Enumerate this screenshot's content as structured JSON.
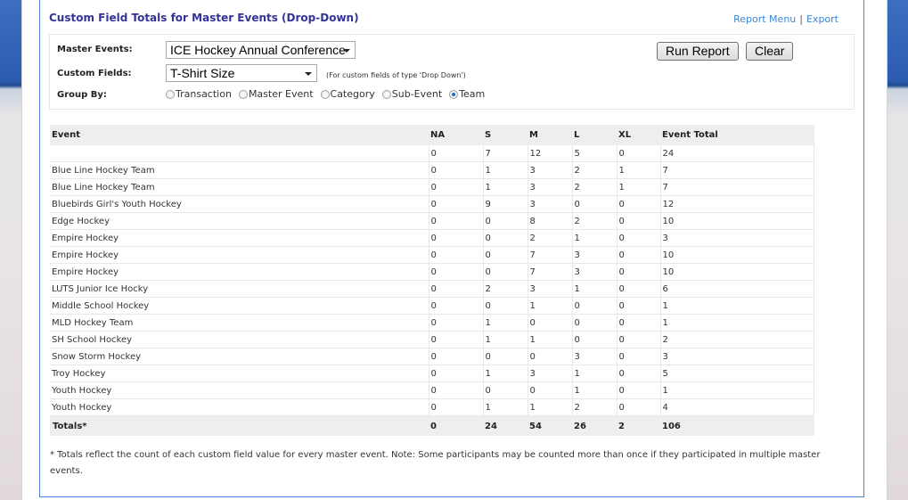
{
  "header": {
    "title": "Custom Field Totals for Master Events (Drop-Down)",
    "report_menu_link": "Report Menu",
    "separator": "|",
    "export_link": "Export"
  },
  "filters": {
    "master_events_label": "Master Events:",
    "master_events_value": "ICE Hockey Annual Conference",
    "custom_fields_label": "Custom Fields:",
    "custom_fields_value": "T-Shirt Size",
    "custom_fields_hint": "(For custom fields of type 'Drop Down')",
    "group_by_label": "Group By:",
    "group_by_options": [
      {
        "label": "Transaction",
        "selected": false
      },
      {
        "label": "Master Event",
        "selected": false
      },
      {
        "label": "Category",
        "selected": false
      },
      {
        "label": "Sub-Event",
        "selected": false
      },
      {
        "label": "Team",
        "selected": true
      }
    ],
    "run_report_button": "Run Report",
    "clear_button": "Clear"
  },
  "table": {
    "columns": [
      "Event",
      "NA",
      "S",
      "M",
      "L",
      "XL",
      "Event Total"
    ],
    "rows": [
      [
        "",
        "0",
        "7",
        "12",
        "5",
        "0",
        "24"
      ],
      [
        "Blue Line Hockey Team",
        "0",
        "1",
        "3",
        "2",
        "1",
        "7"
      ],
      [
        "Blue Line Hockey Team",
        "0",
        "1",
        "3",
        "2",
        "1",
        "7"
      ],
      [
        "Bluebirds Girl's Youth Hockey",
        "0",
        "9",
        "3",
        "0",
        "0",
        "12"
      ],
      [
        "Edge Hockey",
        "0",
        "0",
        "8",
        "2",
        "0",
        "10"
      ],
      [
        "Empire Hockey",
        "0",
        "0",
        "2",
        "1",
        "0",
        "3"
      ],
      [
        "Empire Hockey",
        "0",
        "0",
        "7",
        "3",
        "0",
        "10"
      ],
      [
        "Empire Hockey",
        "0",
        "0",
        "7",
        "3",
        "0",
        "10"
      ],
      [
        "LUTS Junior Ice Hocky",
        "0",
        "2",
        "3",
        "1",
        "0",
        "6"
      ],
      [
        "Middle School Hockey",
        "0",
        "0",
        "1",
        "0",
        "0",
        "1"
      ],
      [
        "MLD Hockey Team",
        "0",
        "1",
        "0",
        "0",
        "0",
        "1"
      ],
      [
        "SH School Hockey",
        "0",
        "1",
        "1",
        "0",
        "0",
        "2"
      ],
      [
        "Snow Storm Hockey",
        "0",
        "0",
        "0",
        "3",
        "0",
        "3"
      ],
      [
        "Troy Hockey",
        "0",
        "1",
        "3",
        "1",
        "0",
        "5"
      ],
      [
        "Youth Hockey",
        "0",
        "0",
        "0",
        "1",
        "0",
        "1"
      ],
      [
        "Youth Hockey",
        "0",
        "1",
        "1",
        "2",
        "0",
        "4"
      ]
    ],
    "totals": [
      "Totals*",
      "0",
      "24",
      "54",
      "26",
      "2",
      "106"
    ]
  },
  "footnote": "* Totals reflect the count of each custom field value for every master event. Note: Some participants may be counted more than once if they participated in multiple master events."
}
